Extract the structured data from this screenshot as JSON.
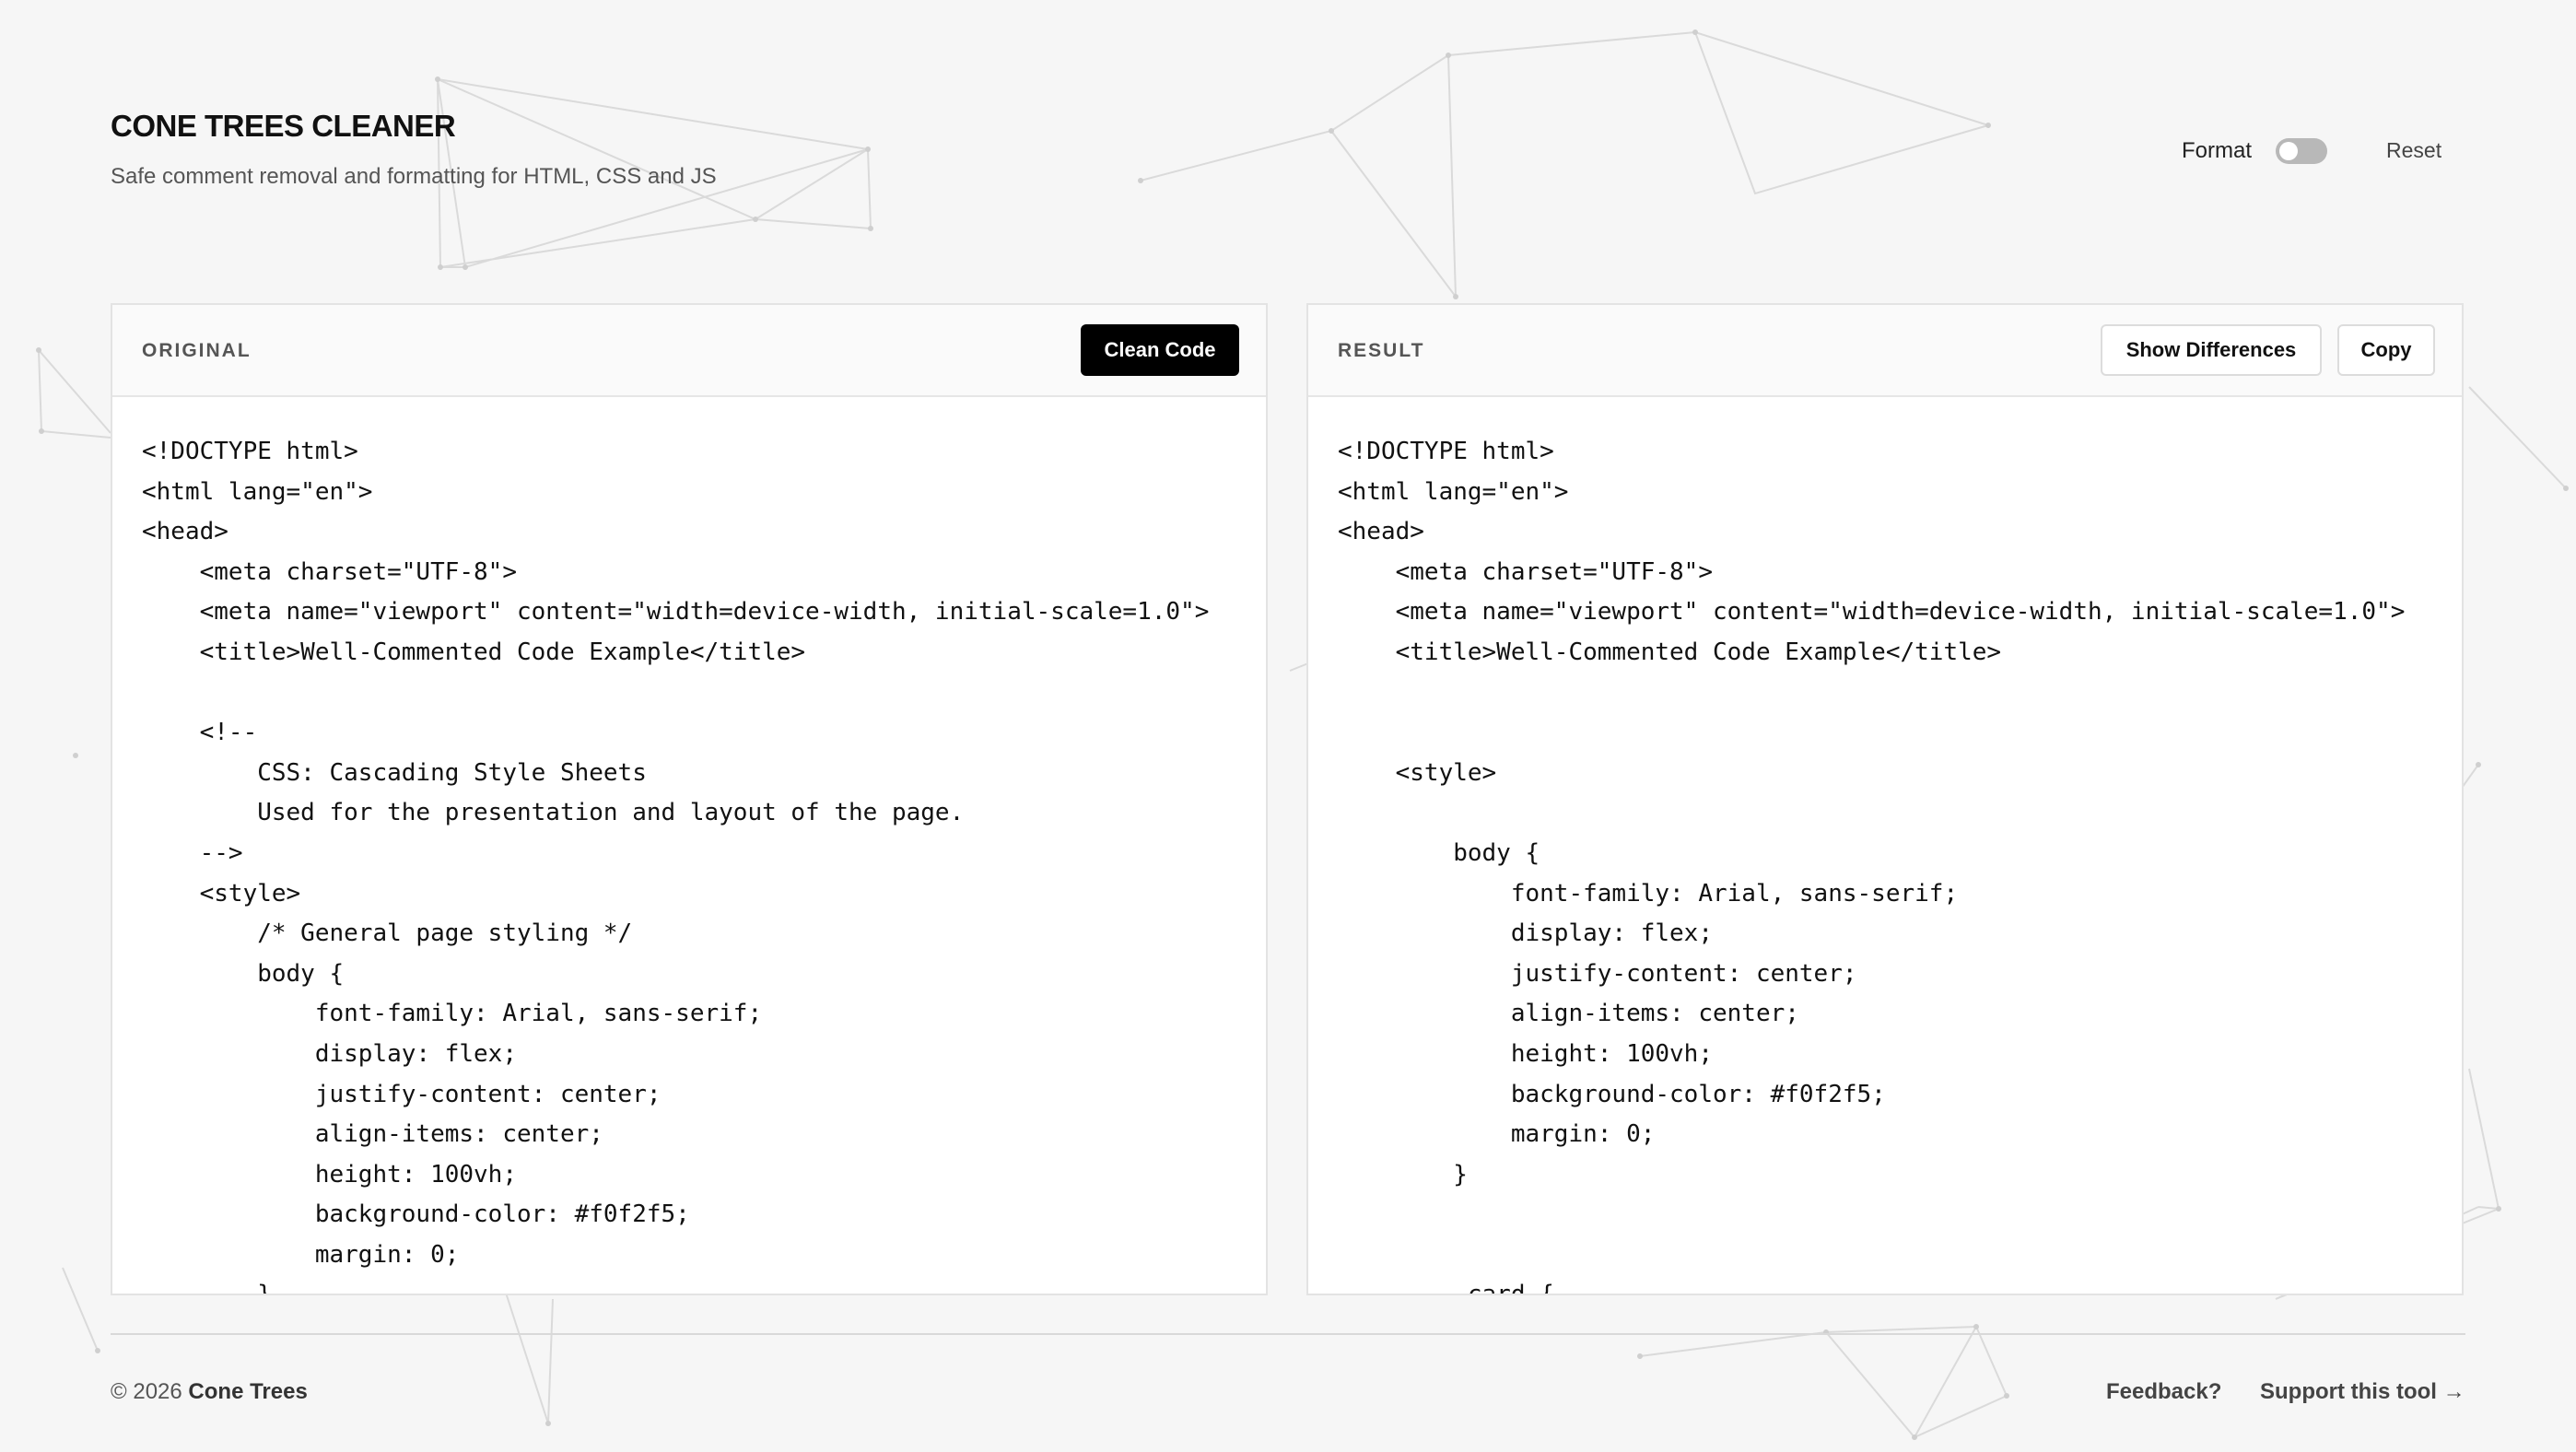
{
  "header": {
    "title": "CONE TREES CLEANER",
    "subtitle": "Safe comment removal and formatting for HTML, CSS and JS"
  },
  "controls": {
    "format_label": "Format",
    "format_enabled": false,
    "reset_label": "Reset"
  },
  "original_panel": {
    "label": "ORIGINAL",
    "clean_button": "Clean Code",
    "code": "<!DOCTYPE html>\n<html lang=\"en\">\n<head>\n    <meta charset=\"UTF-8\">\n    <meta name=\"viewport\" content=\"width=device-width, initial-scale=1.0\">\n    <title>Well-Commented Code Example</title>\n\n    <!--\n        CSS: Cascading Style Sheets\n        Used for the presentation and layout of the page.\n    -->\n    <style>\n        /* General page styling */\n        body {\n            font-family: Arial, sans-serif;\n            display: flex;\n            justify-content: center;\n            align-items: center;\n            height: 100vh;\n            background-color: #f0f2f5;\n            margin: 0;\n        }"
  },
  "result_panel": {
    "label": "RESULT",
    "diff_button": "Show Differences",
    "copy_button": "Copy",
    "code": "<!DOCTYPE html>\n<html lang=\"en\">\n<head>\n    <meta charset=\"UTF-8\">\n    <meta name=\"viewport\" content=\"width=device-width, initial-scale=1.0\">\n    <title>Well-Commented Code Example</title>\n\n\n    <style>\n\n        body {\n            font-family: Arial, sans-serif;\n            display: flex;\n            justify-content: center;\n            align-items: center;\n            height: 100vh;\n            background-color: #f0f2f5;\n            margin: 0;\n        }\n\n\n        .card {"
  },
  "footer": {
    "copyright_prefix": "© 2026",
    "copyright_brand": "Cone Trees",
    "feedback_label": "Feedback?",
    "support_label": "Support this tool →"
  },
  "colors": {
    "background": "#f6f6f6",
    "primary_button": "#000000",
    "panel_border": "#e3e3e3"
  }
}
